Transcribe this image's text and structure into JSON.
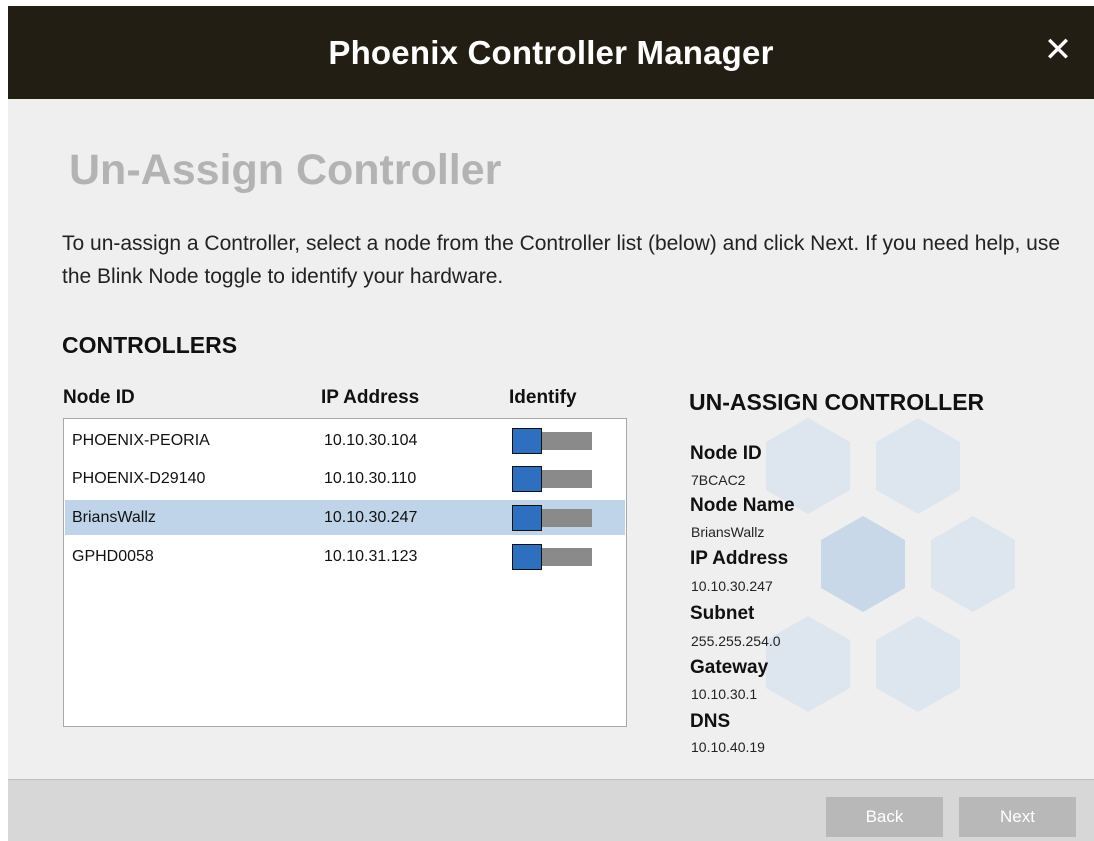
{
  "window": {
    "title": "Phoenix Controller Manager",
    "close_glyph": "✕"
  },
  "page": {
    "heading": "Un-Assign Controller",
    "intro": "To un-assign a Controller, select a node from the Controller list (below) and click Next.  If you need help, use the Blink Node toggle to identify your hardware."
  },
  "controllers": {
    "section_title": "CONTROLLERS",
    "columns": [
      "Node ID",
      "IP Address",
      "Identify"
    ],
    "rows": [
      {
        "node_id": "PHOENIX-PEORIA",
        "ip": "10.10.30.104",
        "identify": false,
        "selected": false
      },
      {
        "node_id": "PHOENIX-D29140",
        "ip": "10.10.30.110",
        "identify": false,
        "selected": false
      },
      {
        "node_id": "BriansWallz",
        "ip": "10.10.30.247",
        "identify": false,
        "selected": true
      },
      {
        "node_id": "GPHD0058",
        "ip": "10.10.31.123",
        "identify": false,
        "selected": false
      }
    ]
  },
  "details": {
    "title": "UN-ASSIGN CONTROLLER",
    "fields": [
      {
        "label": "Node ID",
        "value": "7BCAC2"
      },
      {
        "label": "Node Name",
        "value": "BriansWallz"
      },
      {
        "label": "IP Address",
        "value": "10.10.30.247"
      },
      {
        "label": "Subnet",
        "value": "255.255.254.0"
      },
      {
        "label": "Gateway",
        "value": "10.10.30.1"
      },
      {
        "label": "DNS",
        "value": "10.10.40.19"
      }
    ]
  },
  "footer": {
    "back_label": "Back",
    "next_label": "Next"
  },
  "colors": {
    "titlebar": "#231e14",
    "selected_row": "#bfd4e8",
    "toggle_knob": "#2e6fbf",
    "button": "#b8b8b8"
  },
  "icons": {
    "close": "close-icon",
    "background": "hexagon-pattern"
  }
}
